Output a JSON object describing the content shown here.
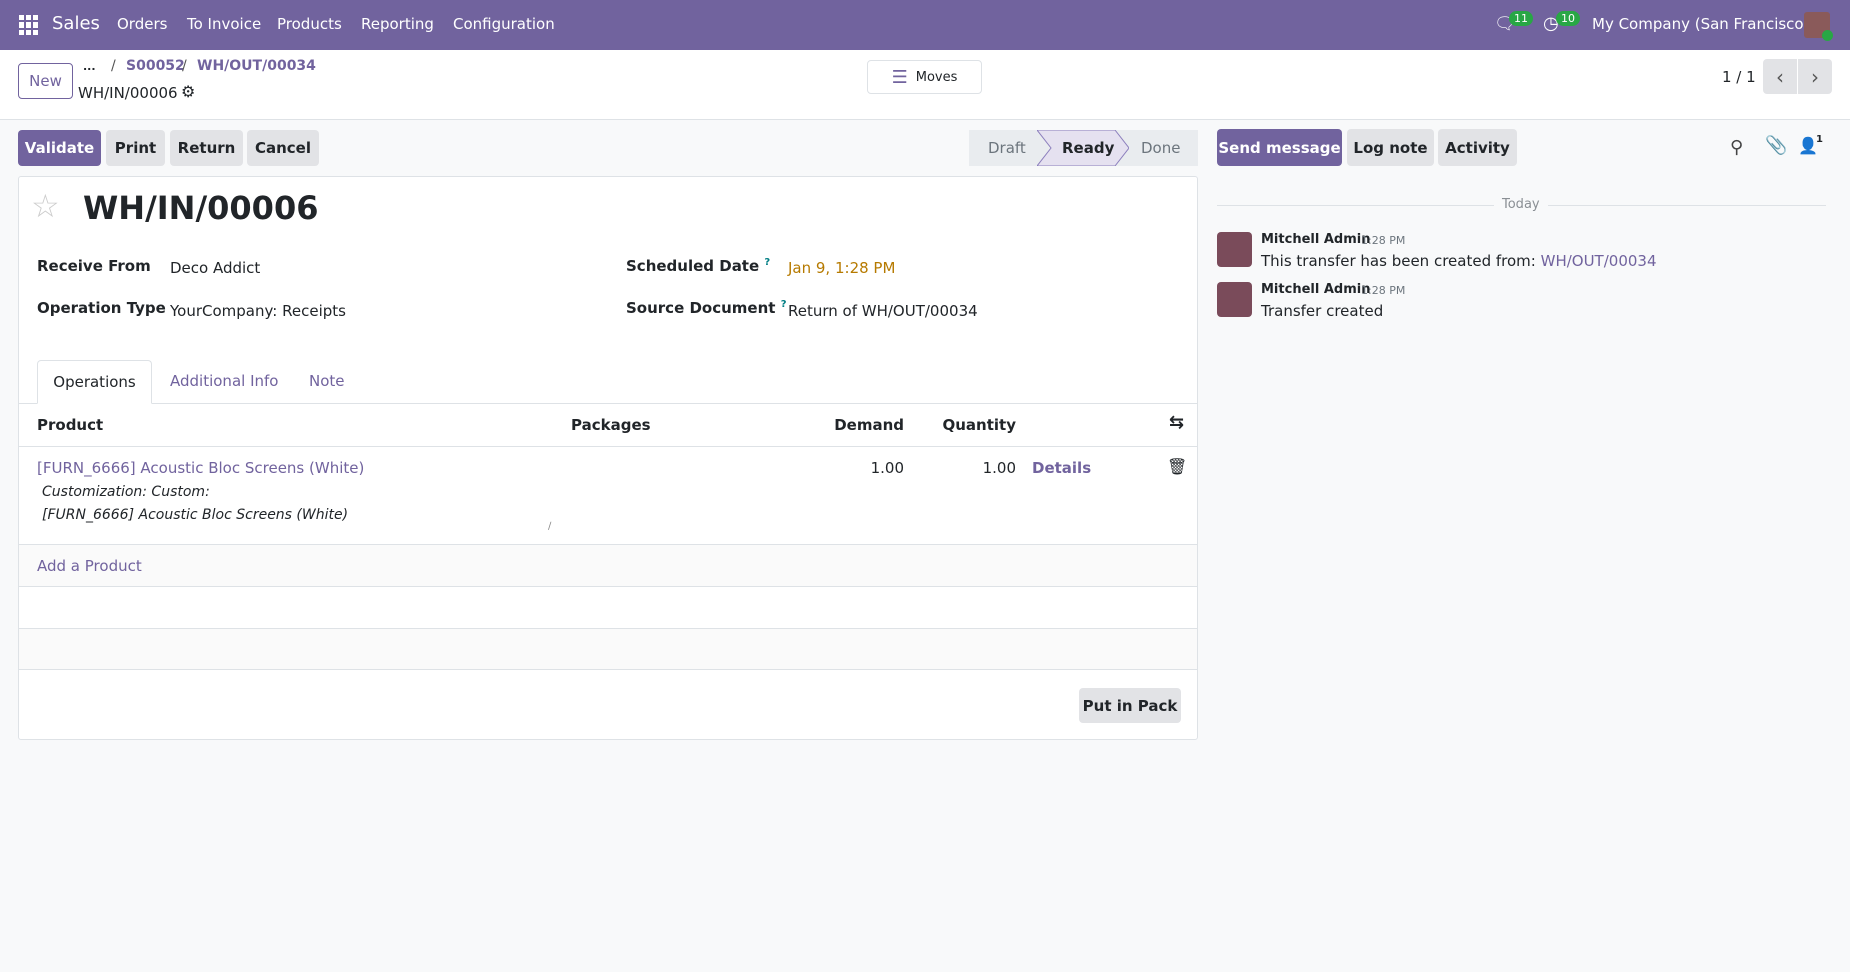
{
  "navbar": {
    "app_name": "Sales",
    "menu": [
      "Orders",
      "To Invoice",
      "Products",
      "Reporting",
      "Configuration"
    ],
    "messages_count": "11",
    "activities_count": "10",
    "company": "My Company (San Francisco)"
  },
  "control_panel": {
    "new_label": "New",
    "breadcrumb": [
      "...",
      "S00052",
      "WH/OUT/00034"
    ],
    "record_name": "WH/IN/00006",
    "moves_label": "Moves",
    "pager": "1 / 1"
  },
  "actions": {
    "validate": "Validate",
    "print": "Print",
    "return": "Return",
    "cancel": "Cancel"
  },
  "status": {
    "steps": [
      "Draft",
      "Ready",
      "Done"
    ],
    "current": "Ready"
  },
  "form": {
    "title": "WH/IN/00006",
    "fields": {
      "receive_from_label": "Receive From",
      "receive_from": "Deco Addict",
      "operation_type_label": "Operation Type",
      "operation_type": "YourCompany: Receipts",
      "scheduled_date_label": "Scheduled Date",
      "scheduled_date": "Jan 9, 1:28 PM",
      "source_document_label": "Source Document",
      "source_document": "Return of WH/OUT/00034",
      "help": "?"
    },
    "tabs": [
      "Operations",
      "Additional Info",
      "Note"
    ],
    "table": {
      "headers": [
        "Product",
        "Packages",
        "Demand",
        "Quantity"
      ],
      "rows": [
        {
          "product": "[FURN_6666] Acoustic Bloc Screens (White)",
          "description_line1": "Customization: Custom:",
          "description_line2": "[FURN_6666] Acoustic Bloc Screens (White)",
          "demand": "1.00",
          "quantity": "1.00",
          "details": "Details"
        }
      ],
      "add_product": "Add a Product"
    },
    "put_in_pack": "Put in Pack"
  },
  "chatter": {
    "send_message": "Send message",
    "log_note": "Log note",
    "activity": "Activity",
    "followers_count": "1",
    "date_separator": "Today",
    "messages": [
      {
        "author": "Mitchell Admin",
        "time": "1:28 PM",
        "text": "This transfer has been created from: ",
        "link": "WH/OUT/00034"
      },
      {
        "author": "Mitchell Admin",
        "time": "1:28 PM",
        "text": "Transfer created"
      }
    ]
  },
  "colors": {
    "brand": "#71639e",
    "date": "#b67a00",
    "badge": "#28a745"
  }
}
